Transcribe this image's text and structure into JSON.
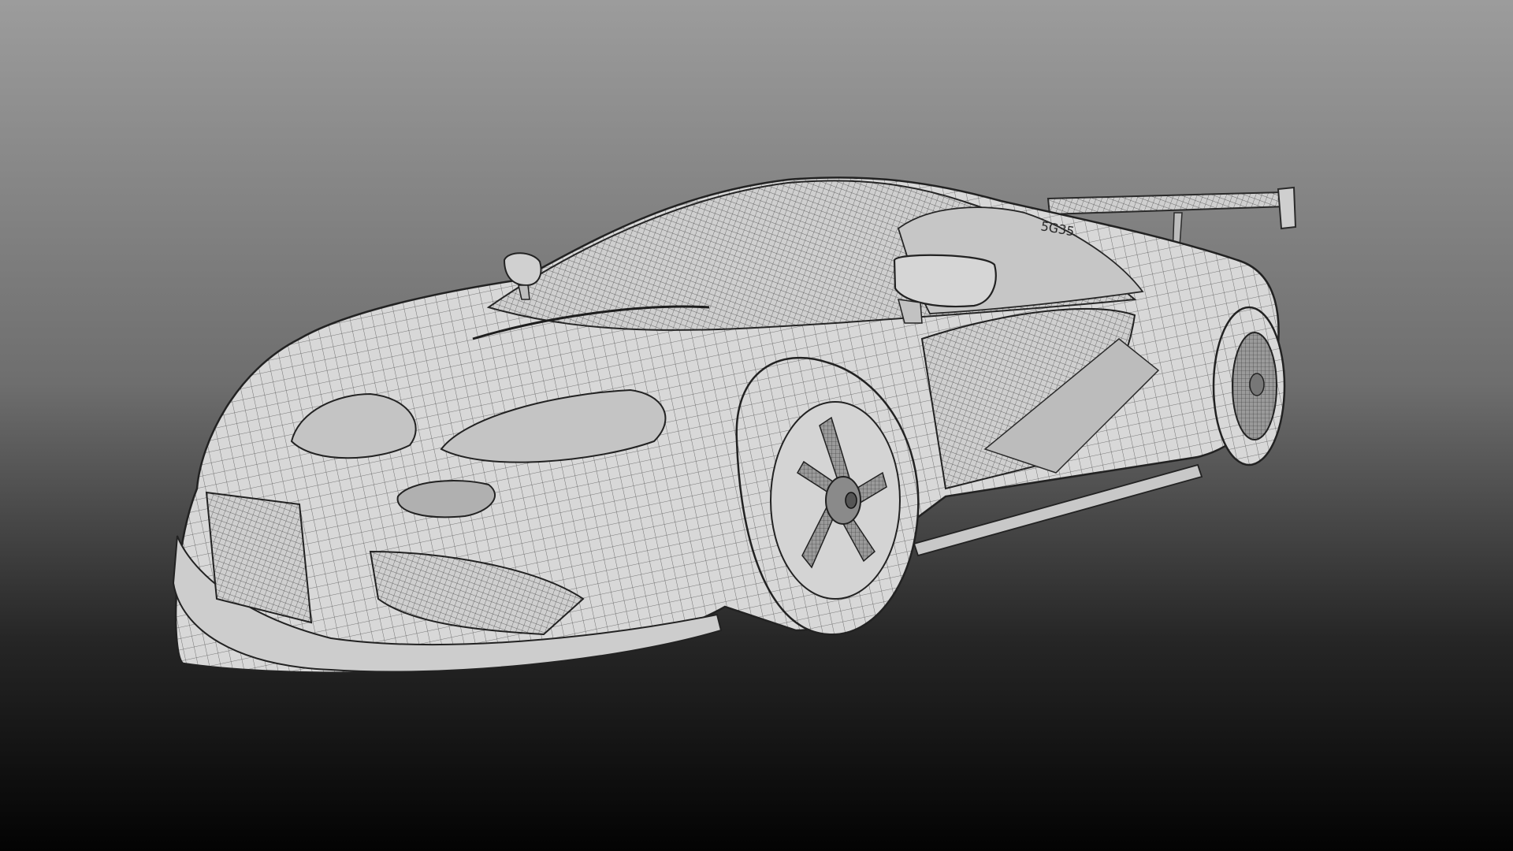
{
  "viewport": {
    "background_top_color": "#9a9a9a",
    "background_bottom_color": "#050505",
    "model_fill_color": "#d9d9d9",
    "wire_color": "#3a3a3a",
    "subject": "wireframe-sports-car"
  },
  "car": {
    "wing_text": "5G35"
  }
}
